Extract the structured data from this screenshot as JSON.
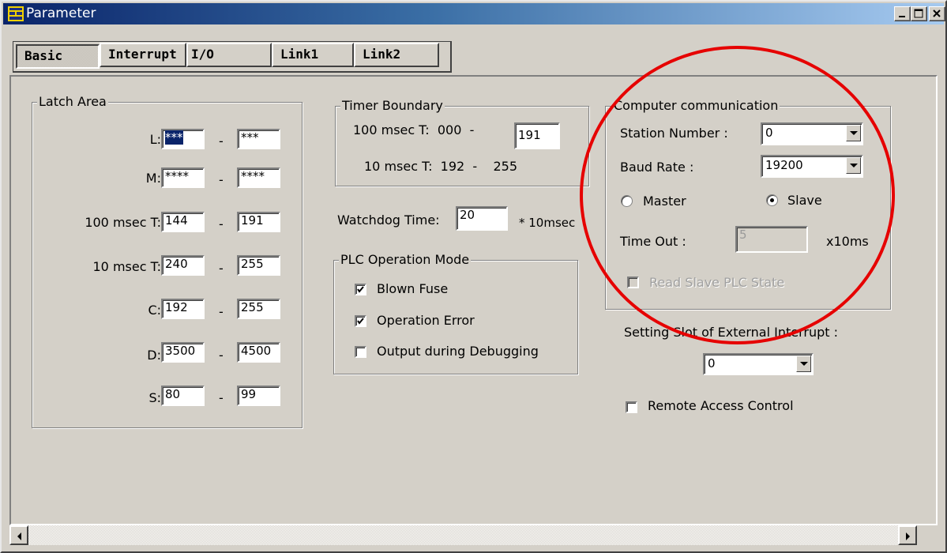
{
  "window": {
    "title": "Parameter"
  },
  "tabs": [
    {
      "label": "Basic",
      "active": true
    },
    {
      "label": "Interrupt"
    },
    {
      "label": "I/O"
    },
    {
      "label": "Link1"
    },
    {
      "label": "Link2"
    }
  ],
  "latch_area": {
    "title": "Latch Area",
    "rows": [
      {
        "label": "L:",
        "from": "***",
        "to": "***"
      },
      {
        "label": "M:",
        "from": "****",
        "to": "****"
      },
      {
        "label": "100 msec T:",
        "from": "144",
        "to": "191"
      },
      {
        "label": "10 msec T:",
        "from": "240",
        "to": "255"
      },
      {
        "label": "C:",
        "from": "192",
        "to": "255"
      },
      {
        "label": "D:",
        "from": "3500",
        "to": "4500"
      },
      {
        "label": "S:",
        "from": "80",
        "to": "99"
      }
    ],
    "dash": "-"
  },
  "timer_boundary": {
    "title": "Timer Boundary",
    "row1_label": "100 msec T:  000  -",
    "row1_value": "191",
    "row2_label": "10 msec T:  192  -    255"
  },
  "watchdog": {
    "label": "Watchdog Time:",
    "value": "20",
    "unit": "* 10msec"
  },
  "plc_mode": {
    "title": "PLC Operation Mode",
    "options": [
      {
        "label": "Blown Fuse",
        "checked": true
      },
      {
        "label": "Operation Error",
        "checked": true
      },
      {
        "label": "Output during Debugging",
        "checked": false
      }
    ]
  },
  "computer_comm": {
    "title": "Computer communication",
    "station_label": "Station Number :",
    "station_value": "0",
    "baud_label": "Baud Rate :",
    "baud_value": "19200",
    "master_label": "Master",
    "slave_label": "Slave",
    "selected": "Slave",
    "timeout_label": "Time Out :",
    "timeout_value": "5",
    "timeout_unit": "x10ms",
    "read_slave_label": "Read Slave PLC State"
  },
  "external_interrupt": {
    "label": "Setting Slot of External Interrupt :",
    "value": "0"
  },
  "remote_access": {
    "label": "Remote Access Control",
    "checked": false
  },
  "colors": {
    "title_start": "#0a246a",
    "title_end": "#a6caf0",
    "annotation": "#e60000",
    "face": "#d4d0c8"
  }
}
